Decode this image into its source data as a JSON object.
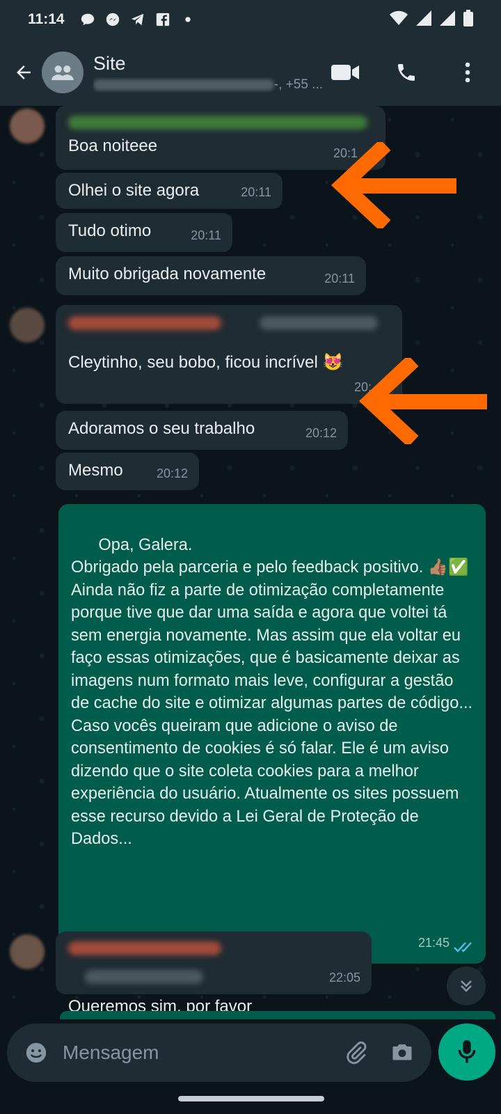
{
  "status_bar": {
    "time": "11:14",
    "icons": [
      "chat-bubble-icon",
      "messenger-icon",
      "telegram-icon",
      "facebook-icon",
      "dot-icon"
    ],
    "right_icons": [
      "wifi-icon",
      "signal-icon",
      "signal-icon",
      "battery-icon"
    ]
  },
  "header": {
    "title": "Site",
    "subtitle_suffix": "-, +55 ...",
    "actions": [
      "video-call-icon",
      "phone-icon",
      "more-vert-icon"
    ]
  },
  "messages": [
    {
      "text": "Boa noiteee",
      "time": "20:1"
    },
    {
      "text": "Olhei o site agora",
      "time": "20:11"
    },
    {
      "text": "Tudo otimo",
      "time": "20:11"
    },
    {
      "text": "Muito obrigada novamente",
      "time": "20:11"
    },
    {
      "text": "Cleytinho, seu bobo, ficou incrível 😻",
      "time": "20:"
    },
    {
      "text": "Adoramos o seu trabalho",
      "time": "20:12"
    },
    {
      "text": "Mesmo",
      "time": "20:12"
    },
    {
      "text": "Opa, Galera.\nObrigado pela parceria e pelo feedback positivo. 👍🏽✅\nAinda não fiz a parte de otimização completamente porque tive que dar uma saída e agora que voltei tá sem energia novamente. Mas assim que ela voltar eu faço essas otimizações, que é basicamente deixar as imagens num formato mais leve, configurar a gestão de cache do site e otimizar algumas partes de código...\nCaso vocês queiram que adicione o aviso de consentimento de cookies é só falar. Ele é um aviso dizendo que o site coleta cookies para a melhor experiência do usuário. Atualmente os sites possuem esse recurso devido a Lei Geral de Proteção de Dados...",
      "time": "21:45"
    },
    {
      "text": "Queremos sim, por favor",
      "time": "22:05"
    }
  ],
  "input": {
    "placeholder": "Mensagem"
  },
  "colors": {
    "incoming_bubble": "#202c33",
    "outgoing_bubble": "#005c4b",
    "accent": "#00a884",
    "arrow": "#ff6a00"
  }
}
